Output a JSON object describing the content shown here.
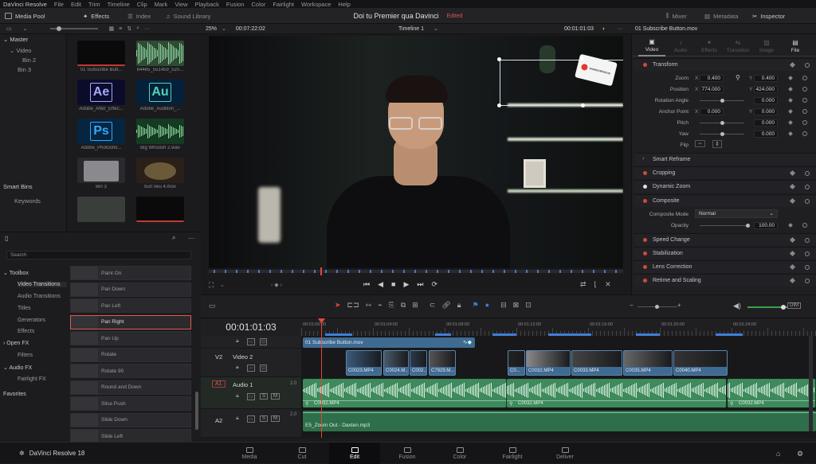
{
  "menu": [
    "DaVinci Resolve",
    "File",
    "Edit",
    "Trim",
    "Timeline",
    "Clip",
    "Mark",
    "View",
    "Playback",
    "Fusion",
    "Color",
    "Fairlight",
    "Workspace",
    "Help"
  ],
  "toolbar": {
    "media_pool": "Media Pool",
    "effects": "Effects",
    "index": "Index",
    "sound_library": "Sound Library",
    "mixer": "Mixer",
    "metadata": "Metadata",
    "inspector": "Inspector"
  },
  "project": {
    "title": "Doi tu Premier qua Davinci",
    "status": "Edited"
  },
  "viewer": {
    "zoom": "25%",
    "source_tc": "00:07:22:02",
    "timeline_name": "Timeline 1",
    "record_tc": "00:01:01:03"
  },
  "bins": {
    "master": "Master",
    "items": [
      "Video",
      "Bin 2",
      "Bin 3"
    ],
    "smart_bins": "Smart Bins",
    "keywords": "Keywords"
  },
  "media": [
    {
      "name": "01 Subscribe Butt...",
      "kind": "dark"
    },
    {
      "name": "64465_551459_520...",
      "kind": "wave"
    },
    {
      "name": "Adobe_After_Effec...",
      "kind": "ae",
      "badge": "Ae"
    },
    {
      "name": "Adobe_Audition_...",
      "kind": "au",
      "badge": "Au"
    },
    {
      "name": "Adobe_Photosho...",
      "kind": "ps",
      "badge": "Ps"
    },
    {
      "name": "Big Whoosh 2.wav",
      "kind": "wave2"
    },
    {
      "name": "Bin 3",
      "kind": "folder"
    },
    {
      "name": "bun neu 4.mov",
      "kind": "drum"
    },
    {
      "name": "",
      "kind": "img"
    },
    {
      "name": "",
      "kind": "dark"
    }
  ],
  "effects": {
    "search_placeholder": "Search",
    "toolbox": "Toolbox",
    "categories": [
      "Video Transitions",
      "Audio Transitions",
      "Titles",
      "Generators",
      "Effects"
    ],
    "open_fx": "Open FX",
    "filters": "Filters",
    "audio_fx": "Audio FX",
    "fairlight_fx": "Fairlight FX",
    "favorites": "Favorites",
    "items": [
      "Paint On",
      "Pan Down",
      "Pan Left",
      "Pan Right",
      "Pan Up",
      "Rotate",
      "Rotate 90",
      "Round and Down",
      "Slice Push",
      "Slide Down",
      "Slide Left"
    ],
    "selected": "Pan Right"
  },
  "inspector": {
    "clip_name": "01 Subscribe Button.mov",
    "tabs": [
      "Video",
      "Audio",
      "Effects",
      "Transition",
      "Image",
      "File"
    ],
    "transform": "Transform",
    "zoom_label": "Zoom",
    "zoom_x": "0.400",
    "zoom_y": "0.400",
    "position_label": "Position",
    "pos_x": "774.000",
    "pos_y": "424.000",
    "rotation_label": "Rotation Angle",
    "rotation": "0.000",
    "anchor_label": "Anchor Point",
    "anchor_x": "0.000",
    "anchor_y": "0.000",
    "pitch_label": "Pitch",
    "pitch": "0.000",
    "yaw_label": "Yaw",
    "yaw": "0.000",
    "flip_label": "Flip",
    "smart_reframe": "Smart Reframe",
    "cropping": "Cropping",
    "dynamic_zoom": "Dynamic Zoom",
    "composite": "Composite",
    "composite_mode_label": "Composite Mode",
    "composite_mode": "Normal",
    "opacity_label": "Opacity",
    "opacity": "100.00",
    "speed_change": "Speed Change",
    "stabilization": "Stabilization",
    "lens_correction": "Lens Correction",
    "retime": "Retime and Scaling",
    "x": "X",
    "y": "Y"
  },
  "timeline": {
    "timecode": "00:01:01:03",
    "ruler": [
      "00:01:00:00",
      "00:01:04:00",
      "00:01:08:00",
      "00:01:12:00",
      "00:01:16:00",
      "00:01:20:00",
      "00:01:24:00"
    ],
    "v2_id": "V2",
    "v2_name": "Video 2",
    "a1_id": "A1",
    "a1_name": "Audio 1",
    "a1_ch": "2.0",
    "a2_id": "A2",
    "a2_ch": "2.0",
    "top_clip": "01 Subscribe Button.mov",
    "video_clips": [
      "C0023.MP4",
      "C0024.M...",
      "C002...",
      "C7929.M...",
      "C0...",
      "C0032.MP4",
      "C0033.MP4",
      "C0035.MP4",
      "C0040.MP4"
    ],
    "audio_clips": [
      "C0032.MP4",
      "C0032.MP4",
      "C0032.MP4"
    ],
    "audio2_clip": "E5_Zoom Out - Daxten.mp3",
    "s": "S",
    "m": "M"
  },
  "app_version": "DaVinci Resolve 18",
  "pages": [
    "Media",
    "Cut",
    "Edit",
    "Fusion",
    "Color",
    "Fairlight",
    "Deliver"
  ],
  "active_page": "Edit",
  "overlay_logo": "DAVINCI RESOLVE",
  "colors": {
    "accent": "#e05a4e",
    "clip_blue": "#3f6a92",
    "audio_green": "#3e8a5c",
    "playhead": "#e0473c"
  }
}
